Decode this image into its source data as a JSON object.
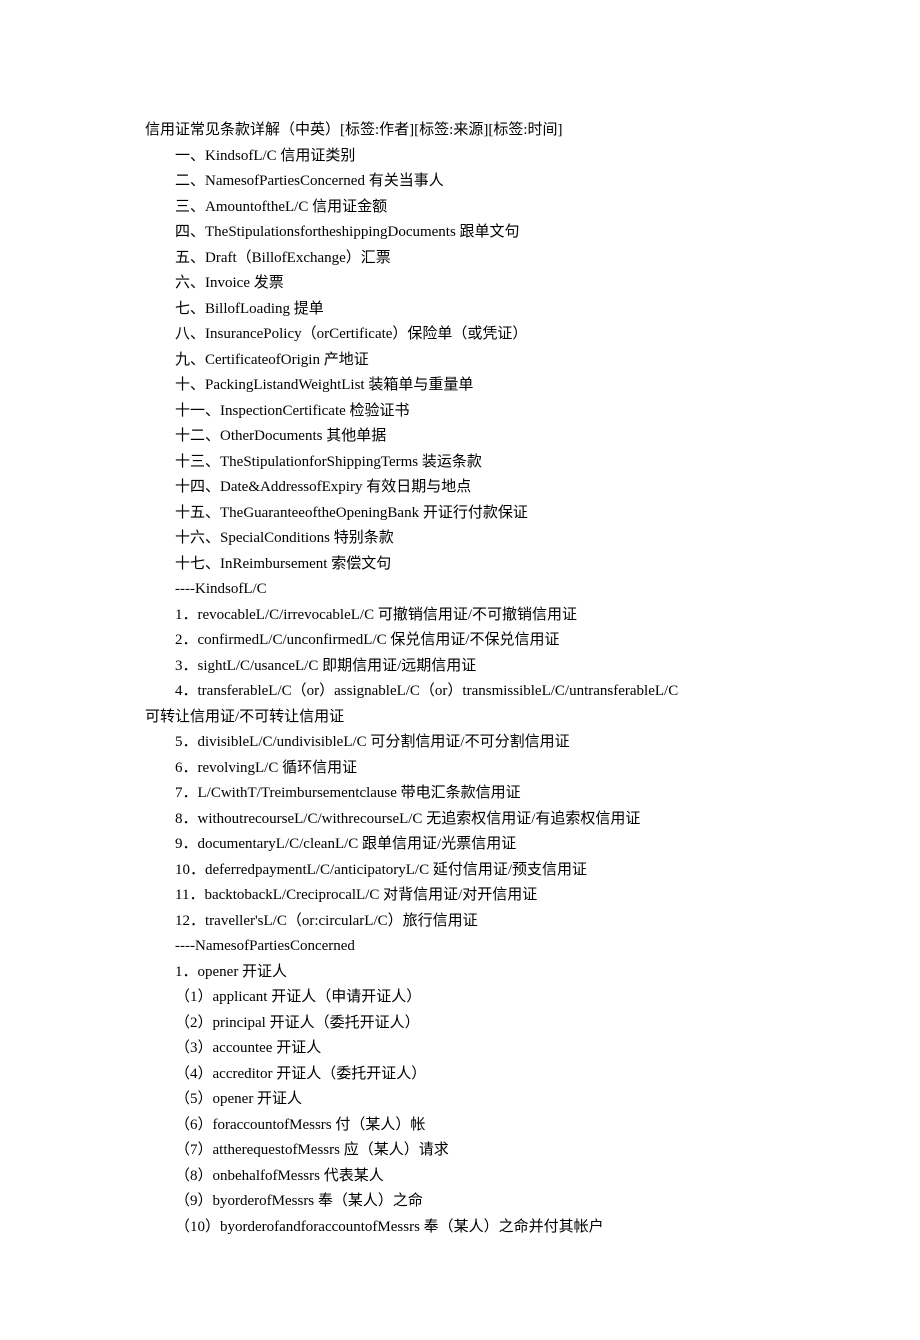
{
  "title": "信用证常见条款详解（中英）[标签:作者][标签:来源][标签:时间]",
  "toc": [
    "一、KindsofL/C 信用证类别",
    "二、NamesofPartiesConcerned 有关当事人",
    "三、AmountoftheL/C 信用证金额",
    "四、TheStipulationsfortheshippingDocuments 跟单文句",
    "五、Draft（BillofExchange）汇票",
    "六、Invoice 发票",
    "七、BillofLoading 提单",
    "八、InsurancePolicy（orCertificate）保险单（或凭证）",
    "九、CertificateofOrigin 产地证",
    "十、PackingListandWeightList 装箱单与重量单",
    "十一、InspectionCertificate 检验证书",
    "十二、OtherDocuments 其他单据",
    "十三、TheStipulationforShippingTerms 装运条款",
    "十四、Date&AddressofExpiry 有效日期与地点",
    "十五、TheGuaranteeoftheOpeningBank 开证行付款保证",
    "十六、SpecialConditions 特别条款",
    "十七、InReimbursement 索偿文句"
  ],
  "section1_header": "----KindsofL/C",
  "section1": [
    "1．revocableL/C/irrevocableL/C 可撤销信用证/不可撤销信用证",
    "2．confirmedL/C/unconfirmedL/C 保兑信用证/不保兑信用证",
    "3．sightL/C/usanceL/C 即期信用证/远期信用证"
  ],
  "section1_item4_part1": "4．transferableL/C（or）assignableL/C（or）transmissibleL/C/untransferableL/C",
  "section1_item4_part2": "可转让信用证/不可转让信用证",
  "section1_rest": [
    "5．divisibleL/C/undivisibleL/C 可分割信用证/不可分割信用证",
    "6．revolvingL/C 循环信用证",
    "7．L/CwithT/Treimbursementclause 带电汇条款信用证",
    "8．withoutrecourseL/C/withrecourseL/C 无追索权信用证/有追索权信用证",
    "9．documentaryL/C/cleanL/C 跟单信用证/光票信用证",
    "10．deferredpaymentL/C/anticipatoryL/C 延付信用证/预支信用证",
    "11．backtobackL/CreciprocalL/C 对背信用证/对开信用证",
    "12．traveller'sL/C（or:circularL/C）旅行信用证"
  ],
  "section2_header": "----NamesofPartiesConcerned",
  "section2_opener": "1．opener 开证人",
  "section2_items": [
    "（1）applicant 开证人（申请开证人）",
    "（2）principal 开证人（委托开证人）",
    "（3）accountee 开证人",
    "（4）accreditor 开证人（委托开证人）",
    "（5）opener 开证人",
    "（6）foraccountofMessrs 付（某人）帐",
    "（7）attherequestofMessrs 应（某人）请求",
    "（8）onbehalfofMessrs 代表某人",
    "（9）byorderofMessrs 奉（某人）之命",
    "（10）byorderofandforaccountofMessrs 奉（某人）之命并付其帐户"
  ]
}
